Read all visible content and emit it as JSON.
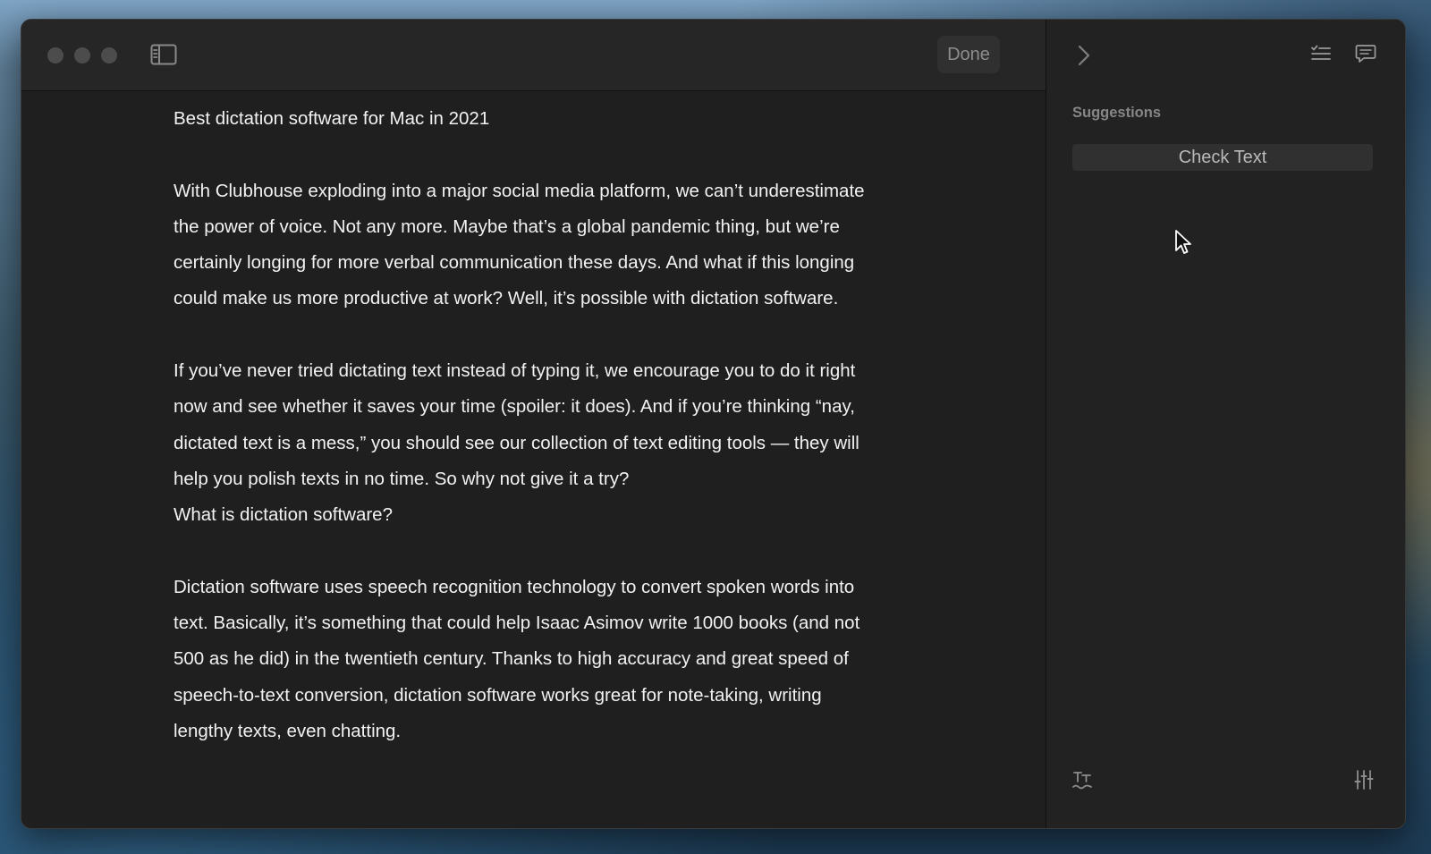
{
  "window": {
    "title": "",
    "toolbar": {
      "done_label": "Done"
    }
  },
  "editor": {
    "paragraphs": [
      "Best dictation software for Mac in 2021",
      "With Clubhouse exploding into a major social media platform, we can’t underestimate the power of voice. Not any more. Maybe that’s a global pandemic thing, but we’re certainly longing for more verbal communication these days. And what if this longing could make us more productive at work? Well, it’s possible with dictation software.",
      "If you’ve never tried dictating text instead of typing it, we encourage you to do it right now and see whether it saves your time (spoiler: it does). And if you’re thinking “nay, dictated text is a mess,” you should see our collection of text editing tools — they will help you polish texts in no time. So why not give it a try?",
      "What is dictation software?",
      "Dictation software uses speech recognition technology to convert spoken words into text. Basically, it’s something that could help Isaac Asimov write 1000 books (and not 500 as he did) in the twentieth century. Thanks to high accuracy and great speed of speech-to-text conversion, dictation software works great for note-taking, writing lengthy texts, even chatting."
    ]
  },
  "sidebar": {
    "heading": "Suggestions",
    "check_text_label": "Check Text"
  },
  "icons": {
    "sidebar_toggle": "sidebar-toggle-icon",
    "collapse": "chevron-right-icon",
    "checklist": "checklist-icon",
    "comments": "comment-icon",
    "translate": "translate-icon",
    "settings": "sliders-icon",
    "pointer": "cursor-icon"
  },
  "colors": {
    "window_background": "#1f1f1f",
    "toolbar_background": "#262626",
    "sidebar_background": "#222222",
    "text": "#f2f2f2",
    "muted_text": "#868686",
    "button_background": "#303030"
  }
}
